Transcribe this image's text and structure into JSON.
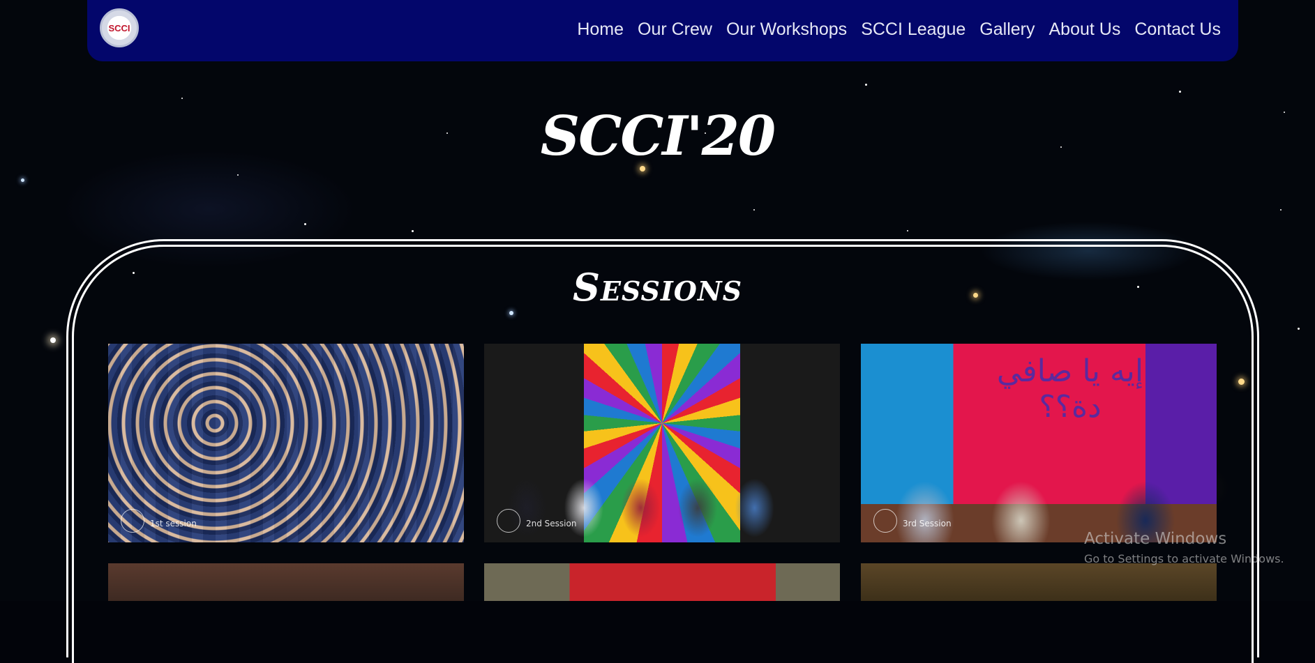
{
  "nav": {
    "logo_text": "SCCI",
    "links": [
      "Home",
      "Our Crew",
      "Our Workshops",
      "SCCI League",
      "Gallery",
      "About Us",
      "Contact Us"
    ]
  },
  "page": {
    "title": "SCCI'20",
    "section_title": "Sessions"
  },
  "gallery": {
    "cards": [
      {
        "label": "1st session"
      },
      {
        "label": "2nd Session"
      },
      {
        "label": "3rd Session",
        "sign_text": "إيه يا صافي دة؟؟"
      },
      {
        "label": ""
      },
      {
        "label": ""
      },
      {
        "label": ""
      }
    ]
  },
  "system": {
    "activate_title": "Activate Windows",
    "activate_sub": "Go to Settings to activate Windows."
  },
  "colors": {
    "navbar": "#03066b",
    "background": "#03060c",
    "text": "#ffffff"
  }
}
